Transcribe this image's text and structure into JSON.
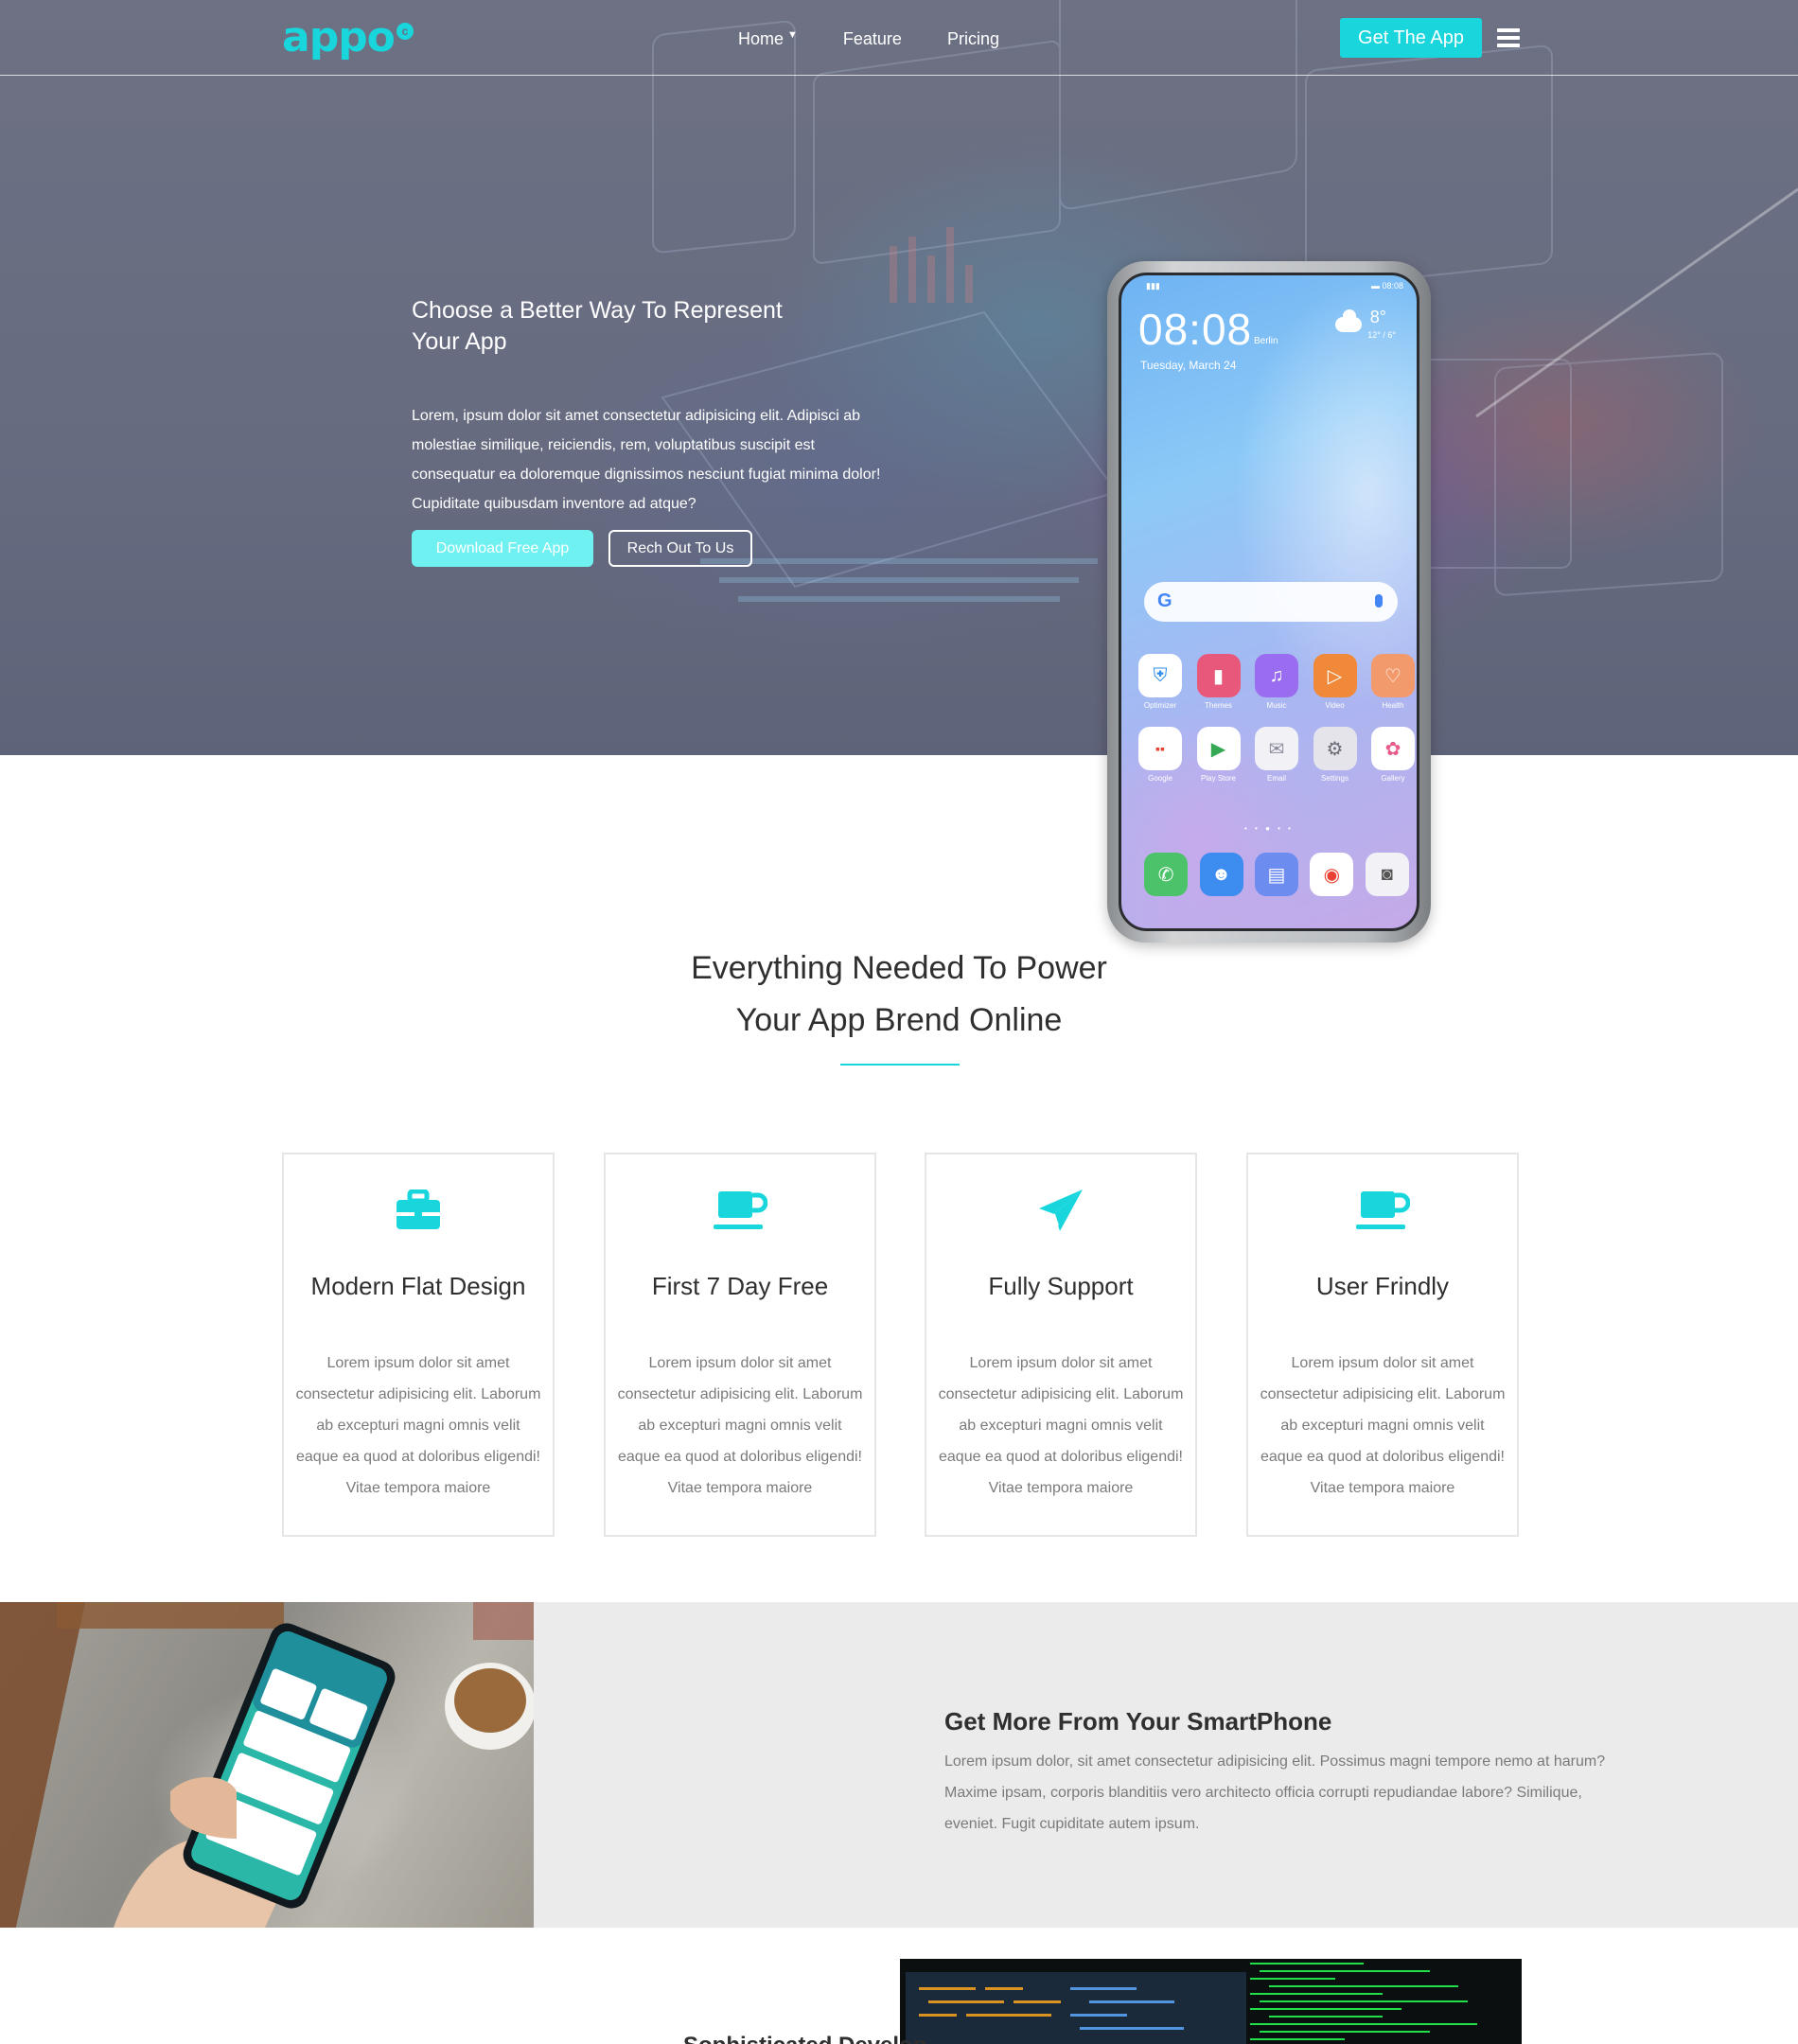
{
  "brand": {
    "logo_text": "appo",
    "logo_mark": "c",
    "accent": "#18d6dc"
  },
  "nav": {
    "links": [
      {
        "label": "Home",
        "has_dropdown": true
      },
      {
        "label": "Feature"
      },
      {
        "label": "Pricing"
      }
    ],
    "cta_label": "Get The App",
    "menu_icon": "hamburger-icon"
  },
  "hero": {
    "title": "Choose a Better Way To Represent Your App",
    "description": "Lorem, ipsum dolor sit amet consectetur adipisicing elit. Adipisci ab molestiae similique, reiciendis, rem, voluptatibus suscipit est consequatur ea doloremque dignissimos nesciunt fugiat minima dolor! Cupiditate quibusdam inventore ad atque?",
    "primary_button": "Download Free App",
    "secondary_button": "Rech Out To Us"
  },
  "phone": {
    "time": "08:08",
    "city": "Berlin",
    "date": "Tuesday, March 24",
    "temp": "8°",
    "temp_range": "12° / 6°",
    "search_logo": "G",
    "apps_row1": [
      "Optimizer",
      "Themes",
      "Music",
      "Video",
      "Health"
    ],
    "apps_row2": [
      "Google",
      "Play Store",
      "Email",
      "Settings",
      "Gallery"
    ]
  },
  "features": {
    "title_line1": "Everything Needed To Power",
    "title_line2": "Your App Brend Online",
    "cards": [
      {
        "icon": "briefcase-icon",
        "title": "Modern Flat Design",
        "text": "Lorem ipsum dolor sit amet consectetur adipisicing elit. Laborum ab excepturi magni omnis velit eaque ea quod at doloribus eligendi! Vitae tempora maiore"
      },
      {
        "icon": "coffee-icon",
        "title": "First 7 Day Free",
        "text": "Lorem ipsum dolor sit amet consectetur adipisicing elit. Laborum ab excepturi magni omnis velit eaque ea quod at doloribus eligendi! Vitae tempora maiore"
      },
      {
        "icon": "paper-plane-icon",
        "title": "Fully Support",
        "text": "Lorem ipsum dolor sit amet consectetur adipisicing elit. Laborum ab excepturi magni omnis velit eaque ea quod at doloribus eligendi! Vitae tempora maiore"
      },
      {
        "icon": "coffee-icon",
        "title": "User Frindly",
        "text": "Lorem ipsum dolor sit amet consectetur adipisicing elit. Laborum ab excepturi magni omnis velit eaque ea quod at doloribus eligendi! Vitae tempora maiore"
      }
    ]
  },
  "smartphone": {
    "title": "Get More From Your SmartPhone",
    "text": "Lorem ipsum dolor, sit amet consectetur adipisicing elit. Possimus magni tempore nemo at harum? Maxime ipsam, corporis blanditiis vero architecto officia corrupti repudiandae labore? Similique, eveniet. Fugit cupiditate autem ipsum."
  },
  "next_section": {
    "partial_title": "Sophisticated Develop"
  }
}
